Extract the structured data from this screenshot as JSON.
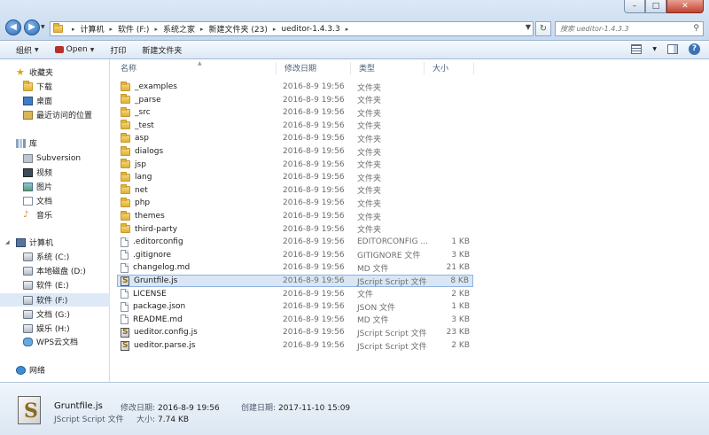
{
  "window": {
    "minimize": "–",
    "maximize": "□",
    "close": "✕"
  },
  "address": {
    "crumbs": [
      "计算机",
      "软件 (F:)",
      "系统之家",
      "新建文件夹 (23)",
      "ueditor-1.4.3.3"
    ],
    "refresh": "↻"
  },
  "search": {
    "placeholder": "搜索 ueditor-1.4.3.3"
  },
  "toolbar": {
    "organize": "组织",
    "open": "Open",
    "print": "打印",
    "new_folder": "新建文件夹"
  },
  "sidebar": {
    "favorites": {
      "title": "收藏夹",
      "items": [
        "下载",
        "桌面",
        "最近访问的位置"
      ]
    },
    "libraries": {
      "title": "库",
      "items": [
        "Subversion",
        "视频",
        "图片",
        "文档",
        "音乐"
      ]
    },
    "computer": {
      "title": "计算机",
      "items": [
        "系统 (C:)",
        "本地磁盘 (D:)",
        "软件 (E:)",
        "软件 (F:)",
        "文档 (G:)",
        "娱乐 (H:)",
        "WPS云文档"
      ]
    },
    "network": {
      "title": "网络"
    }
  },
  "columns": {
    "name": "名称",
    "date": "修改日期",
    "type": "类型",
    "size": "大小"
  },
  "files": [
    {
      "name": "_examples",
      "date": "2016-8-9 19:56",
      "type": "文件夹",
      "size": "",
      "kind": "folder"
    },
    {
      "name": "_parse",
      "date": "2016-8-9 19:56",
      "type": "文件夹",
      "size": "",
      "kind": "folder"
    },
    {
      "name": "_src",
      "date": "2016-8-9 19:56",
      "type": "文件夹",
      "size": "",
      "kind": "folder"
    },
    {
      "name": "_test",
      "date": "2016-8-9 19:56",
      "type": "文件夹",
      "size": "",
      "kind": "folder"
    },
    {
      "name": "asp",
      "date": "2016-8-9 19:56",
      "type": "文件夹",
      "size": "",
      "kind": "folder"
    },
    {
      "name": "dialogs",
      "date": "2016-8-9 19:56",
      "type": "文件夹",
      "size": "",
      "kind": "folder"
    },
    {
      "name": "jsp",
      "date": "2016-8-9 19:56",
      "type": "文件夹",
      "size": "",
      "kind": "folder"
    },
    {
      "name": "lang",
      "date": "2016-8-9 19:56",
      "type": "文件夹",
      "size": "",
      "kind": "folder"
    },
    {
      "name": "net",
      "date": "2016-8-9 19:56",
      "type": "文件夹",
      "size": "",
      "kind": "folder"
    },
    {
      "name": "php",
      "date": "2016-8-9 19:56",
      "type": "文件夹",
      "size": "",
      "kind": "folder"
    },
    {
      "name": "themes",
      "date": "2016-8-9 19:56",
      "type": "文件夹",
      "size": "",
      "kind": "folder"
    },
    {
      "name": "third-party",
      "date": "2016-8-9 19:56",
      "type": "文件夹",
      "size": "",
      "kind": "folder"
    },
    {
      "name": ".editorconfig",
      "date": "2016-8-9 19:56",
      "type": "EDITORCONFIG ...",
      "size": "1 KB",
      "kind": "file"
    },
    {
      "name": ".gitignore",
      "date": "2016-8-9 19:56",
      "type": "GITIGNORE 文件",
      "size": "3 KB",
      "kind": "file"
    },
    {
      "name": "changelog.md",
      "date": "2016-8-9 19:56",
      "type": "MD 文件",
      "size": "21 KB",
      "kind": "file"
    },
    {
      "name": "Gruntfile.js",
      "date": "2016-8-9 19:56",
      "type": "JScript Script 文件",
      "size": "8 KB",
      "kind": "js",
      "selected": true
    },
    {
      "name": "LICENSE",
      "date": "2016-8-9 19:56",
      "type": "文件",
      "size": "2 KB",
      "kind": "file"
    },
    {
      "name": "package.json",
      "date": "2016-8-9 19:56",
      "type": "JSON 文件",
      "size": "1 KB",
      "kind": "file"
    },
    {
      "name": "README.md",
      "date": "2016-8-9 19:56",
      "type": "MD 文件",
      "size": "3 KB",
      "kind": "file"
    },
    {
      "name": "ueditor.config.js",
      "date": "2016-8-9 19:56",
      "type": "JScript Script 文件",
      "size": "23 KB",
      "kind": "js"
    },
    {
      "name": "ueditor.parse.js",
      "date": "2016-8-9 19:56",
      "type": "JScript Script 文件",
      "size": "2 KB",
      "kind": "js"
    }
  ],
  "details": {
    "name": "Gruntfile.js",
    "type": "JScript Script 文件",
    "modified_label": "修改日期:",
    "modified": "2016-8-9 19:56",
    "created_label": "创建日期:",
    "created": "2017-11-10 15:09",
    "size_label": "大小:",
    "size": "7.74 KB"
  }
}
